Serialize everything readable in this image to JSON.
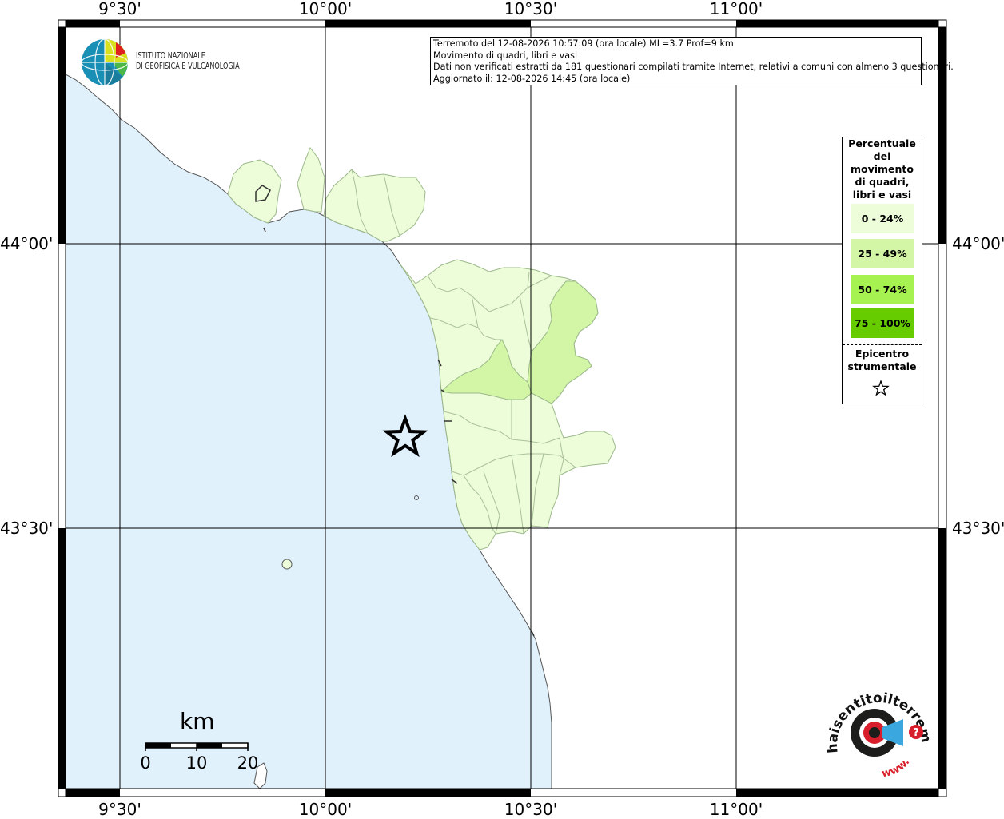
{
  "map": {
    "longitude_ticks": [
      "9°30'",
      "10°00'",
      "10°30'",
      "11°00'"
    ],
    "latitude_ticks": [
      "44°00'",
      "43°30'"
    ],
    "epicenter": {
      "lon": 10.167,
      "lat": 43.68
    },
    "colors": {
      "sea": "#e0f1fc",
      "land_0_24": "#edfcd9",
      "land_25_49": "#d2f6a6",
      "land_50_74": "#a6f250",
      "land_75_100": "#66cc00"
    }
  },
  "logo": {
    "line1": "ISTITUTO NAZIONALE",
    "line2": "DI GEOFISICA E VULCANOLOGIA"
  },
  "info": {
    "line1": "Terremoto del 12-08-2026 10:57:09 (ora locale) ML=3.7 Prof=9 km",
    "line2": "Movimento di quadri, libri e vasi",
    "line3": "Dati non verificati estratti da 181 questionari compilati tramite Internet, relativi a comuni con almeno 3 questionari.",
    "line4": "Aggiornato il: 12-08-2026 14:45 (ora locale)"
  },
  "legend": {
    "title_lines": [
      "Percentuale",
      "del",
      "movimento",
      "di quadri,",
      "libri e vasi"
    ],
    "classes": [
      {
        "label": "0 - 24%",
        "color": "#edfcd9"
      },
      {
        "label": "25 - 49%",
        "color": "#d2f6a6"
      },
      {
        "label": "50 - 74%",
        "color": "#a6f250"
      },
      {
        "label": "75 - 100%",
        "color": "#66cc00"
      }
    ],
    "epicenter_lines": [
      "Epicentro",
      "strumentale"
    ]
  },
  "scale": {
    "unit": "km",
    "labels": [
      "0",
      "10",
      "20"
    ]
  },
  "hsit": {
    "arc_text": "haisentitoilterremoto.it",
    "www": "www.",
    "question": "?"
  }
}
